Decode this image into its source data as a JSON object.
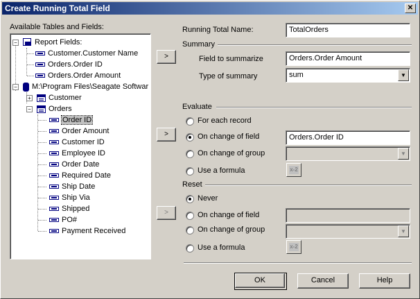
{
  "window": {
    "title": "Create Running Total Field",
    "close_glyph": "✕"
  },
  "left": {
    "label": "Available Tables and Fields:",
    "tree": [
      {
        "text": "Report Fields:",
        "icon": "report-fields-icon",
        "toggle": "−"
      },
      {
        "text": "Customer.Customer Name",
        "icon": "field-icon"
      },
      {
        "text": "Orders.Order ID",
        "icon": "field-icon"
      },
      {
        "text": "Orders.Order Amount",
        "icon": "field-icon"
      },
      {
        "text": "M:\\Program Files\\Seagate Softwar",
        "icon": "database-icon",
        "toggle": "−"
      },
      {
        "text": "Customer",
        "icon": "table-icon",
        "toggle": "+"
      },
      {
        "text": "Orders",
        "icon": "table-icon",
        "toggle": "−"
      },
      {
        "text": "Order ID",
        "icon": "field-icon",
        "selected": true
      },
      {
        "text": "Order Amount",
        "icon": "field-icon"
      },
      {
        "text": "Customer ID",
        "icon": "field-icon"
      },
      {
        "text": "Employee ID",
        "icon": "field-icon"
      },
      {
        "text": "Order Date",
        "icon": "field-icon"
      },
      {
        "text": "Required Date",
        "icon": "field-icon"
      },
      {
        "text": "Ship Date",
        "icon": "field-icon"
      },
      {
        "text": "Ship Via",
        "icon": "field-icon"
      },
      {
        "text": "Shipped",
        "icon": "field-icon"
      },
      {
        "text": "PO#",
        "icon": "field-icon"
      },
      {
        "text": "Payment Received",
        "icon": "field-icon"
      }
    ]
  },
  "arrow_glyph": ">",
  "running_total": {
    "label": "Running Total Name:",
    "value": "TotalOrders"
  },
  "summary": {
    "heading": "Summary",
    "field_label": "Field to summarize",
    "field_value": "Orders.Order Amount",
    "type_label": "Type of summary",
    "type_value": "sum"
  },
  "evaluate": {
    "heading": "Evaluate",
    "options": [
      "For each record",
      "On change of field",
      "On change of group",
      "Use a formula"
    ],
    "selected": "On change of field",
    "field_value": "Orders.Order ID",
    "group_value": ""
  },
  "reset": {
    "heading": "Reset",
    "options": [
      "Never",
      "On change of field",
      "On change of group",
      "Use a formula"
    ],
    "selected": "Never",
    "field_value": "",
    "group_value": ""
  },
  "formula_button_glyph": "x-2",
  "buttons": {
    "ok": "OK",
    "cancel": "Cancel",
    "help": "Help"
  }
}
